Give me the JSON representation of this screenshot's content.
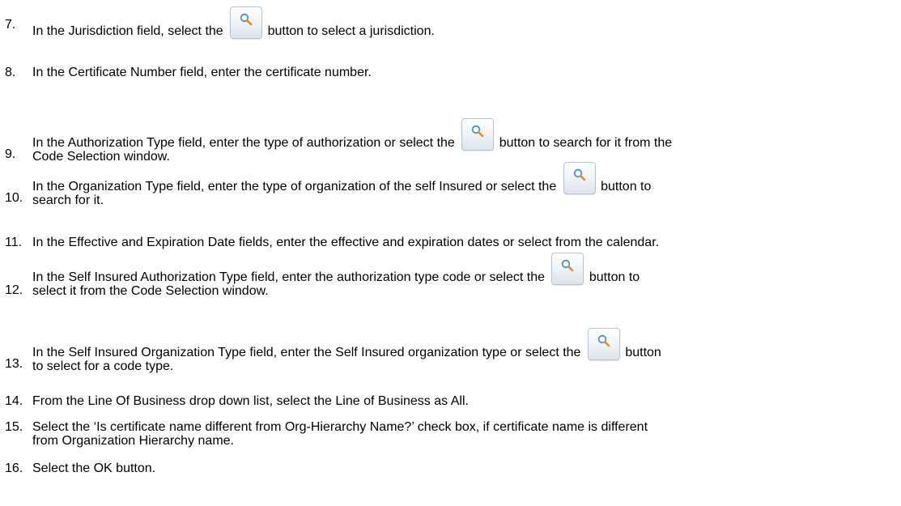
{
  "steps": [
    {
      "number": "7.",
      "before": "In the Jurisdiction field, select the ",
      "after": " button  to select a jurisdiction.",
      "continuation": ""
    },
    {
      "number": "8.",
      "text": "In the Certificate Number field, enter the certificate number."
    },
    {
      "number": "9.",
      "before": "In the Authorization Type field, enter the type of authorization or select the ",
      "after": " button to search for it from the",
      "continuation": "Code Selection window."
    },
    {
      "number": "10.",
      "before": "In the Organization Type field, enter the type of organization of the self Insured or select the ",
      "after": "  button to",
      "continuation": "search for it."
    },
    {
      "number": "11.",
      "text": " In the Effective and Expiration Date fields, enter the effective and expiration dates or select from the calendar."
    },
    {
      "number": "12.",
      "before": " In the Self Insured Authorization Type field, enter the authorization type code or select  the ",
      "after": " button to",
      "continuation": "select it from the Code Selection window."
    },
    {
      "number": "13.",
      "before": " In the Self Insured Organization Type field, enter the Self Insured organization type or select the ",
      "after": " button",
      "continuation": "to select for a code type."
    },
    {
      "number": "14.",
      "text": " From the Line Of Business drop down list, select the Line of Business as All."
    },
    {
      "number": "15.",
      "text": "Select the ‘Is certificate name different from Org-Hierarchy Name?’ check box, if certificate name is different",
      "continuation": "from Organization Hierarchy name."
    },
    {
      "number": "16.",
      "text": "Select the OK button."
    }
  ],
  "icon_name": "magnifier-search-icon"
}
